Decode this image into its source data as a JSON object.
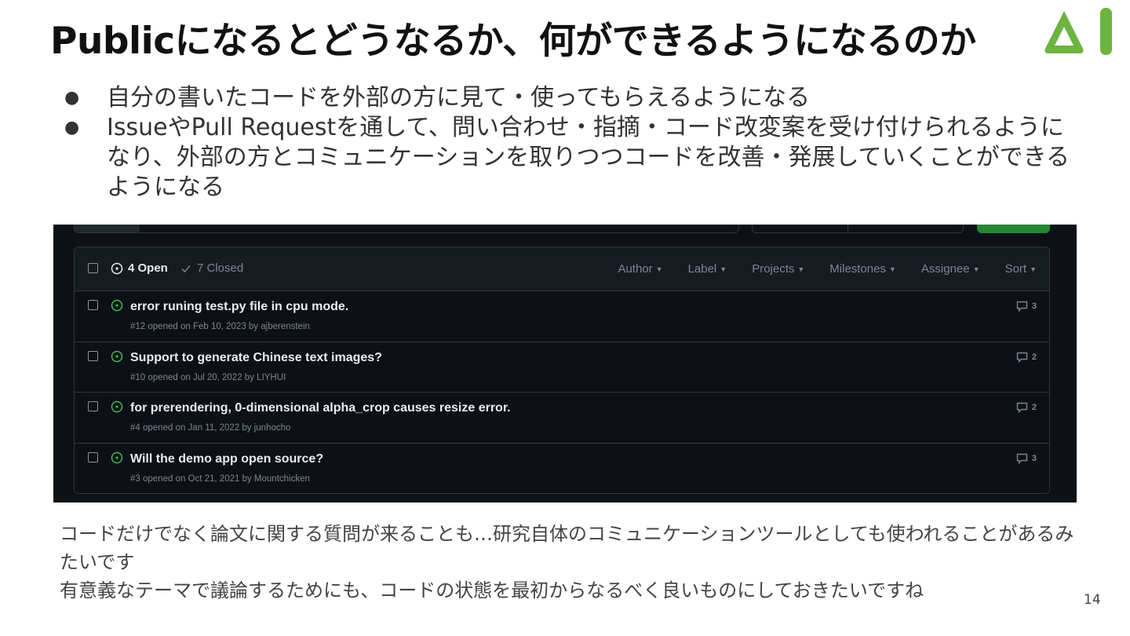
{
  "slide": {
    "title": "Publicになるとどうなるか、何ができるようになるのか",
    "logo_color": "#6cb33f",
    "bullets": [
      "自分の書いたコードを外部の方に見て・使ってもらえるようになる",
      "IssueやPull Requestを通して、問い合わせ・指摘・コード改変案を受け付けられるようになり、外部の方とコミュニケーションを取りつつコードを改善・発展していくことができるようになる"
    ],
    "footnote_line1": "コードだけでなく論文に関する質問が来ることも…研究自体のコミュニケーションツールとしても使われることがあるみたいです",
    "footnote_line2": "有意義なテーマで議論するためにも、コードの状態を最初からなるべく良いものにしておきたいですね",
    "page_number": "14"
  },
  "github": {
    "theme": {
      "background": "#0d1117",
      "header_bg": "#161b22",
      "border": "#30363d",
      "open_green": "#3fb950",
      "muted": "#7d8590",
      "text": "#e6edf3",
      "new_button": "#238636"
    },
    "open_label": "4 Open",
    "closed_label": "7 Closed",
    "filters": [
      "Author",
      "Label",
      "Projects",
      "Milestones",
      "Assignee",
      "Sort"
    ],
    "issues": [
      {
        "title": "error runing test.py file in cpu mode.",
        "meta": "#12 opened on Feb 10, 2023 by ajberenstein",
        "comments": "3"
      },
      {
        "title": "Support to generate Chinese text images?",
        "meta": "#10 opened on Jul 20, 2022 by LIYHUI",
        "comments": "2"
      },
      {
        "title": "for prerendering, 0-dimensional alpha_crop causes resize error.",
        "meta": "#4 opened on Jan 11, 2022 by junhocho",
        "comments": "2"
      },
      {
        "title": "Will the demo app open source?",
        "meta": "#3 opened on Oct 21, 2021 by Mountchicken",
        "comments": "3"
      }
    ]
  }
}
